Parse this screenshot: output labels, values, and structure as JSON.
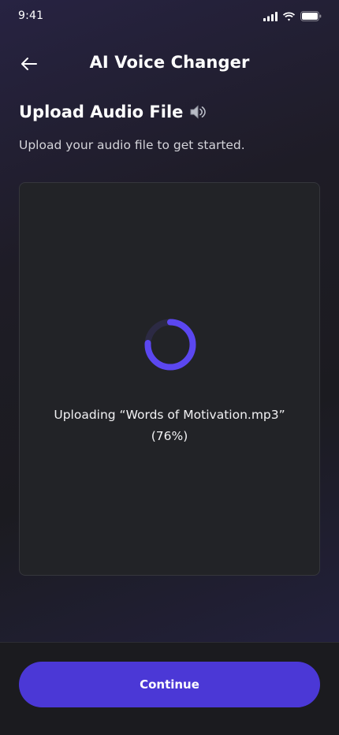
{
  "status_bar": {
    "time": "9:41"
  },
  "header": {
    "title": "AI Voice Changer"
  },
  "upload": {
    "title": "Upload Audio File",
    "title_icon": "speaker-icon",
    "subtitle": "Upload your audio file to get started.",
    "status_line1": "Uploading “Words of Motivation.mp3”",
    "status_line2": "(76%)",
    "progress": 0.76
  },
  "footer": {
    "continue_label": "Continue"
  },
  "colors": {
    "accent": "#4b38d6",
    "spinner": "#5b47f0",
    "card": "#222327"
  }
}
